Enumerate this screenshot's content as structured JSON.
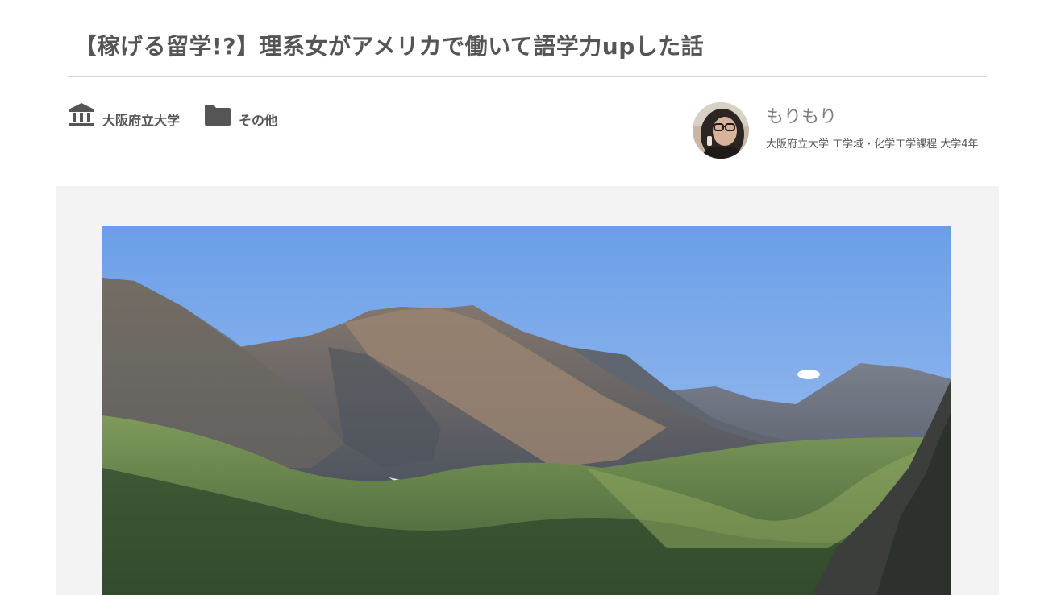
{
  "article": {
    "title": "【稼げる留学!?】理系女がアメリカで働いて語学力upした話"
  },
  "tags": [
    {
      "icon": "university-icon",
      "label": "大阪府立大学"
    },
    {
      "icon": "folder-icon",
      "label": "その他"
    }
  ],
  "author": {
    "name": "もりもり",
    "affiliation": "大阪府立大学 工学域・化学工学課程 大学4年"
  },
  "hero": {
    "subject": "mountain-landscape-photo"
  },
  "colors": {
    "text": "#555555",
    "author_name": "#7d7d7d",
    "divider": "#d6d6d6",
    "panel_bg": "#f3f3f3"
  }
}
